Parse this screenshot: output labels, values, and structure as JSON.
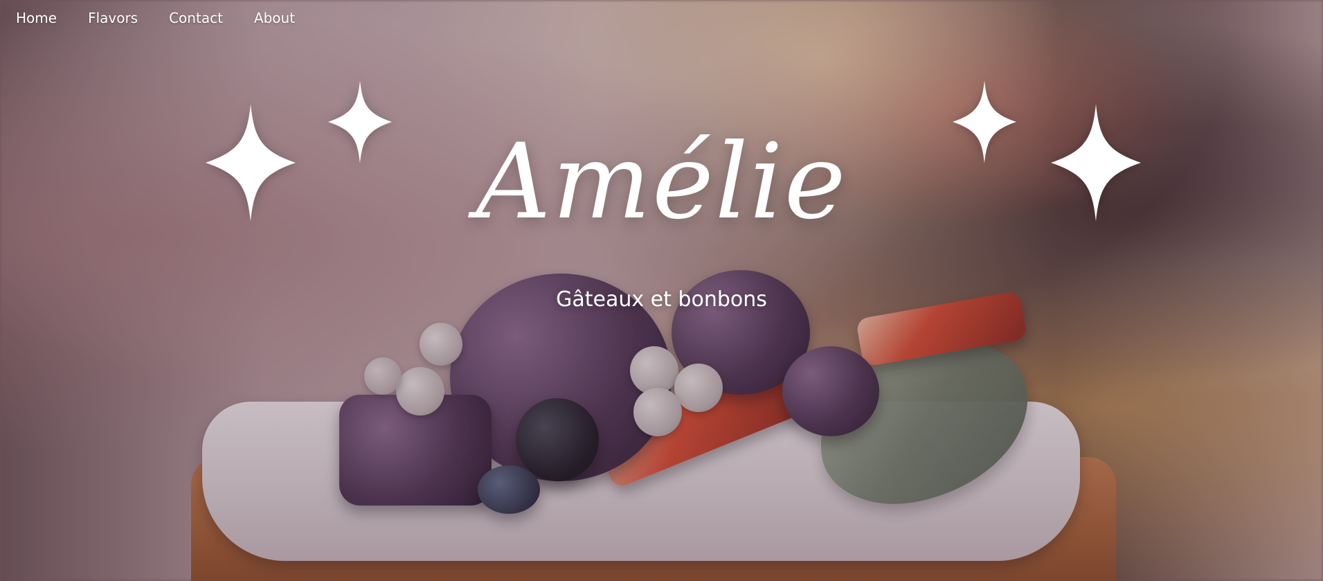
{
  "nav": {
    "items": [
      {
        "label": "Home"
      },
      {
        "label": "Flavors"
      },
      {
        "label": "Contact"
      },
      {
        "label": "About"
      }
    ]
  },
  "hero": {
    "title": "Amélie",
    "subtitle": "Gâteaux et bonbons"
  },
  "icons": {
    "sparkle": "four-point-star"
  },
  "colors": {
    "text": "#ffffff"
  }
}
